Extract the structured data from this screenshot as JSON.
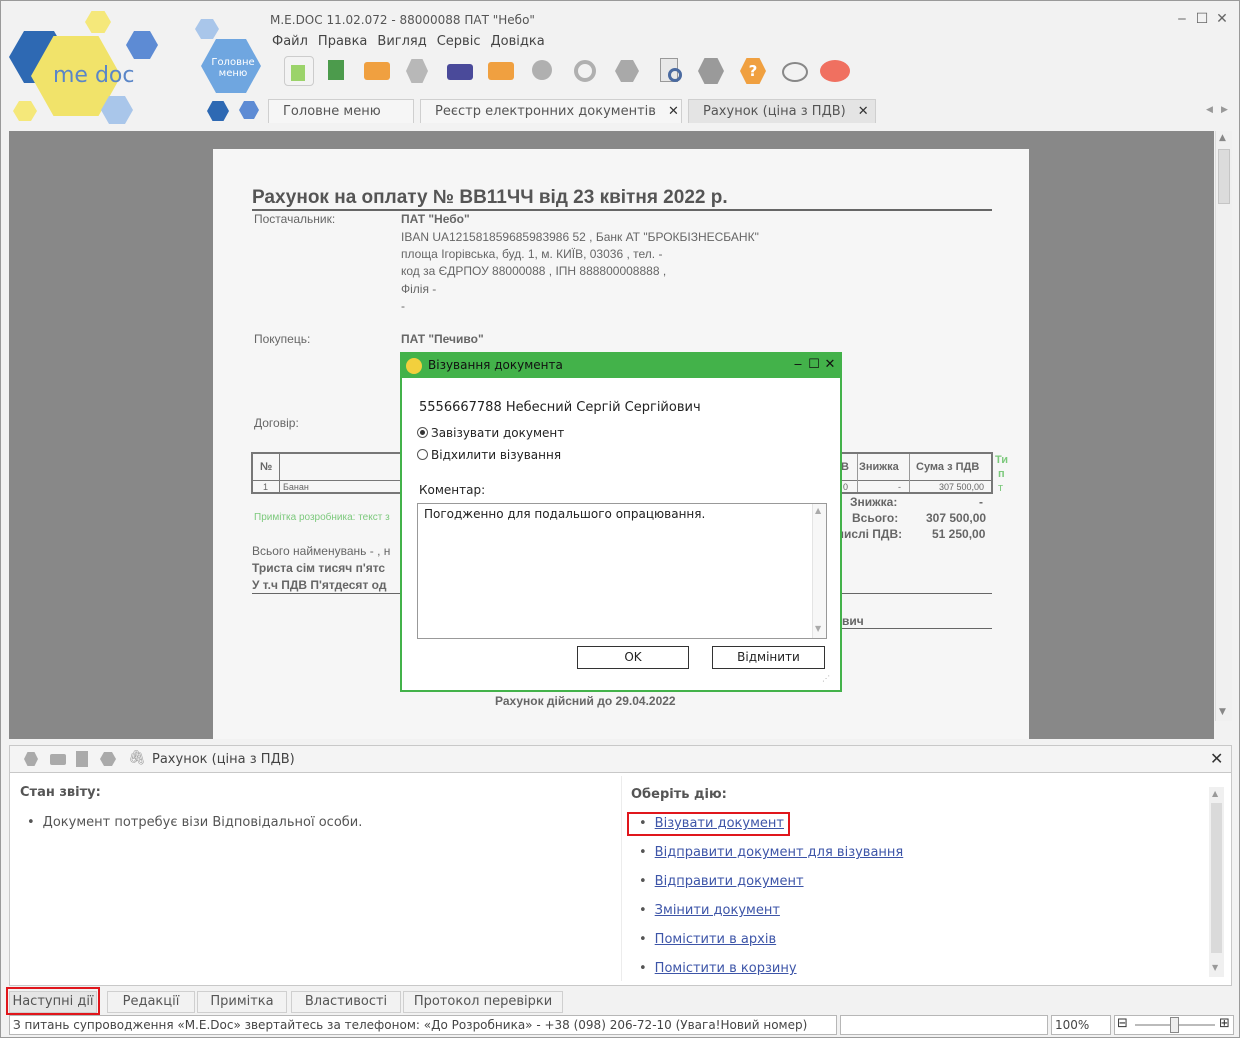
{
  "window": {
    "title": "M.E.DOC 11.02.072 - 88000088 ПАТ \"Небо\"",
    "logo_text": "me doc",
    "home_label": "Головне меню"
  },
  "menu": [
    "Файл",
    "Правка",
    "Вигляд",
    "Сервіс",
    "Довідка"
  ],
  "toolbar_icons": [
    "new-document-icon",
    "copy-icon",
    "send-envelope-icon",
    "stamp-icon",
    "print-icon",
    "receive-envelope-icon",
    "search-icon",
    "refresh-icon",
    "inbox-icon",
    "find-document-icon",
    "sign-check-icon",
    "help-icon",
    "chat-icon",
    "feedback-icon"
  ],
  "tabs": [
    {
      "label": "Головне меню",
      "closable": false
    },
    {
      "label": "Реєстр електронних документів",
      "closable": true
    },
    {
      "label": "Рахунок (ціна з ПДВ)",
      "closable": true
    }
  ],
  "document": {
    "title": "Рахунок на оплату № ВВ11ЧЧ від 23 квітня 2022 р.",
    "supplier_label": "Постачальник:",
    "supplier_lines": [
      "ПАТ \"Небо\"",
      "IBAN UA121581859685983986 52 , Банк АТ \"БРОКБІЗНЕСБАНК\"",
      "площа Ігорівська, буд. 1, м. КИЇВ, 03036 , тел. -",
      "код за ЄДРПОУ 88000088 , ІПН 888800008888 ,",
      "Філія -",
      "-"
    ],
    "buyer_label": "Покупець:",
    "buyer_name": "ПАТ \"Печиво\"",
    "contract_label": "Договір:",
    "table_headers": [
      "№",
      "В",
      "Знижка",
      "Сума з ПДВ"
    ],
    "table_row": [
      "1",
      "Банан",
      "0",
      "-",
      "307 500,00"
    ],
    "side_text": [
      "Ти",
      "п",
      "т"
    ],
    "dev_note": "Примітка розробника: текст з",
    "totals": [
      {
        "label": "Знижка:",
        "value": "-"
      },
      {
        "label": "Всього:",
        "value": "307 500,00"
      },
      {
        "label": "числі ПДВ:",
        "value": "51 250,00"
      }
    ],
    "total_items": "Всього найменувань - , н",
    "total_words": "Триста сім тисяч п'ятс",
    "vat_words": "У т.ч ПДВ П'ятдесят од",
    "signer_tail": "вич",
    "valid_until": "Рахунок дійсний до  29.04.2022"
  },
  "dialog": {
    "title": "Візування документа",
    "signer": "5556667788 Небесний Сергій Сергійович",
    "option_approve": "Завізувати документ",
    "option_reject": "Відхилити візування",
    "selected": "approve",
    "comment_label": "Коментар:",
    "comment_value": "Погодженно для подальшого опрацювання.",
    "ok_label": "OK",
    "cancel_label": "Відмінити"
  },
  "panel": {
    "title": "Рахунок (ціна з ПДВ)",
    "state_title": "Стан звіту:",
    "state_items": [
      "Документ потребує візи Відповідальної особи."
    ],
    "actions_title": "Оберіть дію:",
    "actions": [
      "Візувати документ",
      "Відправити документ для візування",
      "Відправити документ",
      "Змінити документ",
      "Помістити в архів",
      "Помістити в корзину"
    ],
    "highlighted_action": "Візувати документ"
  },
  "bottom_tabs": [
    "Наступні дії",
    "Редакції",
    "Примітка",
    "Властивості",
    "Протокол перевірки"
  ],
  "status": {
    "support_text": "З питань супроводження «M.E.Doc» звертайтесь за телефоном: «До Розробника» - +38 (098) 206-72-10 (Увага!Новий номер)",
    "zoom": "100%"
  },
  "colors": {
    "accent_green": "#43b24a",
    "highlight_red": "#e0161c",
    "link_blue": "#3d55a8"
  }
}
